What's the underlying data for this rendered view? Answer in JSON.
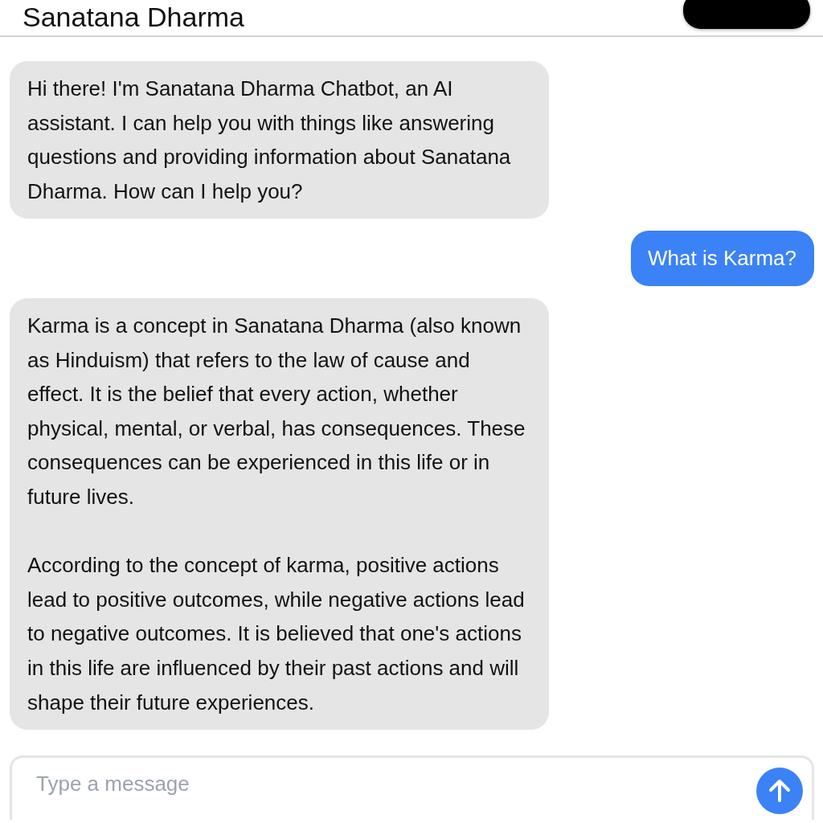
{
  "header": {
    "title": "Sanatana Dharma"
  },
  "messages": [
    {
      "kind": "bot",
      "paragraphs": [
        "Hi there! I'm Sanatana Dharma Chatbot, an AI assistant. I can help you with things like answering questions and providing information about Sanatana Dharma. How can I help you?"
      ]
    },
    {
      "kind": "user",
      "paragraphs": [
        "What is Karma?"
      ]
    },
    {
      "kind": "bot",
      "paragraphs": [
        "Karma is a concept in Sanatana Dharma (also known as Hinduism) that refers to the law of cause and effect. It is the belief that every action, whether physical, mental, or verbal, has consequences. These consequences can be experienced in this life or in future lives.",
        "According to the concept of karma, positive actions lead to positive outcomes, while negative actions lead to negative outcomes. It is believed that one's actions in this life are influenced by their past actions and will shape their future experiences."
      ]
    }
  ],
  "composer": {
    "placeholder": "Type a message"
  }
}
